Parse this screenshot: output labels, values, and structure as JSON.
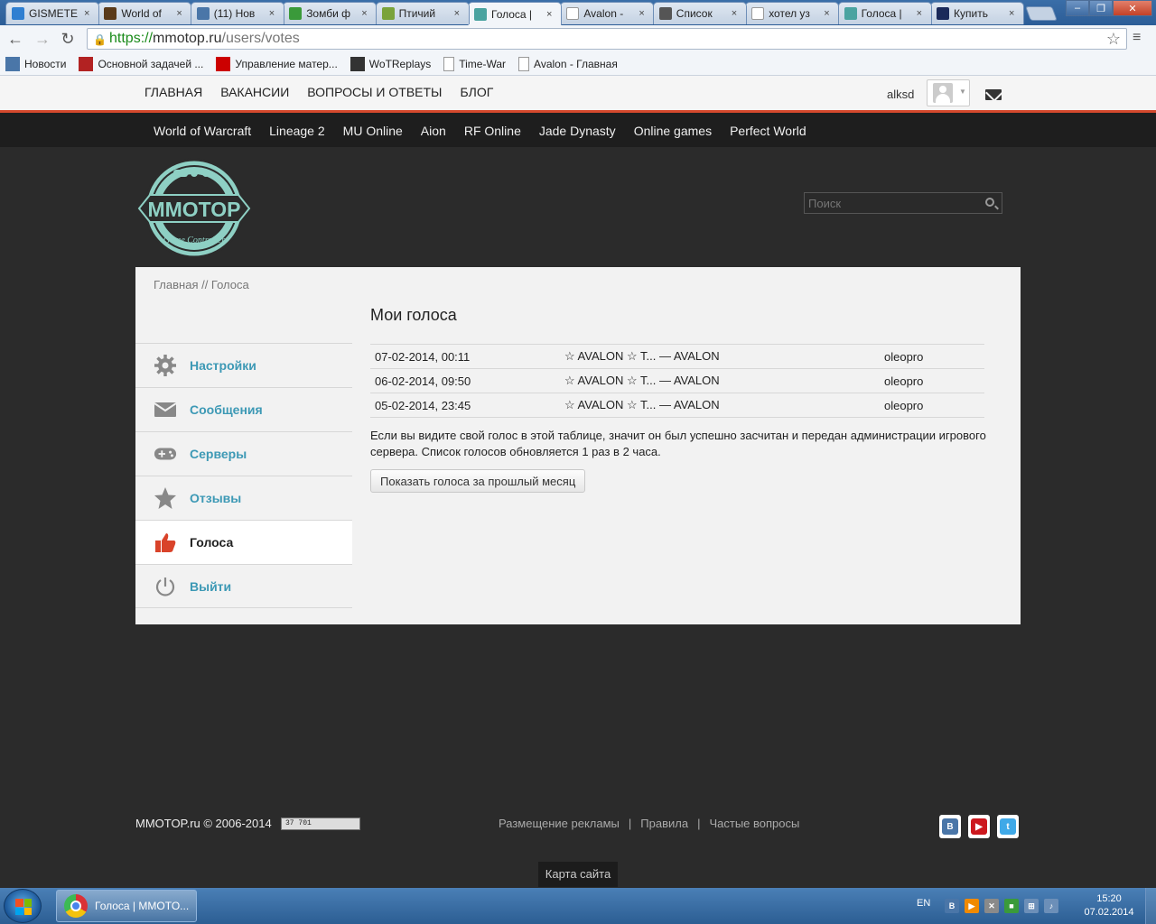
{
  "browser": {
    "tabs": [
      {
        "label": "GISMETE",
        "icon": "gismeteo-icon",
        "color": "#2f7fd1"
      },
      {
        "label": "World of",
        "icon": "wot-icon",
        "color": "#5a3a1a"
      },
      {
        "label": "(11) Нов",
        "icon": "vk-icon",
        "color": "#4a76a8"
      },
      {
        "label": "Зомби ф",
        "icon": "zombie-game-icon",
        "color": "#3a9a3a"
      },
      {
        "label": "Птичий",
        "icon": "bird-game-icon",
        "color": "#7aa33b"
      },
      {
        "label": "Голоса |",
        "icon": "mmotop-icon",
        "color": "#4aa3a0",
        "active": true
      },
      {
        "label": "Avalon -",
        "icon": "page-icon",
        "color": "#ffffff"
      },
      {
        "label": "Список",
        "icon": "gms-icon",
        "color": "#555555"
      },
      {
        "label": "хотел уз",
        "icon": "page-icon",
        "color": "#ffffff"
      },
      {
        "label": "Голоса |",
        "icon": "mmotop-icon",
        "color": "#4aa3a0"
      },
      {
        "label": "Купить",
        "icon": "shop-icon",
        "color": "#1b2a5a"
      }
    ],
    "url": {
      "scheme": "https://",
      "host": "mmotop.ru",
      "path": "/users/votes"
    },
    "bookmarks": [
      {
        "label": "Новости",
        "icon": "vk-icon",
        "color": "#4a76a8"
      },
      {
        "label": "Основной задачей ...",
        "icon": "b-icon",
        "color": "#b22222"
      },
      {
        "label": "Управление матер...",
        "icon": "aup-icon",
        "color": "#cc0000"
      },
      {
        "label": "WoTReplays",
        "icon": "camera-icon",
        "color": "#333333"
      },
      {
        "label": "Time-War",
        "icon": "page-icon",
        "color": "#ffffff"
      },
      {
        "label": "Avalon - Главная",
        "icon": "page-icon",
        "color": "#ffffff"
      }
    ]
  },
  "site": {
    "topnav": [
      "ГЛАВНАЯ",
      "ВАКАНСИИ",
      "ВОПРОСЫ И ОТВЕТЫ",
      "БЛОГ"
    ],
    "username": "alksd",
    "games": [
      "World of Warcraft",
      "Lineage 2",
      "MU Online",
      "Aion",
      "RF Online",
      "Jade Dynasty",
      "Online games",
      "Perfect World"
    ],
    "logo_text": "MMOTOP",
    "logo_sub": "Game Controller",
    "search_placeholder": "Поиск",
    "breadcrumb": "Главная // Голоса",
    "sidebar": [
      {
        "label": "Настройки",
        "icon": "gear-icon"
      },
      {
        "label": "Сообщения",
        "icon": "envelope-icon"
      },
      {
        "label": "Серверы",
        "icon": "gamepad-icon"
      },
      {
        "label": "Отзывы",
        "icon": "star-icon"
      },
      {
        "label": "Голоса",
        "icon": "thumbs-up-icon",
        "active": true
      },
      {
        "label": "Выйти",
        "icon": "power-icon"
      }
    ],
    "page_title": "Мои голоса",
    "votes": [
      {
        "date": "07-02-2014, 00:11",
        "server": "☆ AVALON ☆ T... — AVALON",
        "user": "oleopro"
      },
      {
        "date": "06-02-2014, 09:50",
        "server": "☆ AVALON ☆ T... — AVALON",
        "user": "oleopro"
      },
      {
        "date": "05-02-2014, 23:45",
        "server": "☆ AVALON ☆ T... — AVALON",
        "user": "oleopro"
      }
    ],
    "note": "Если вы видите свой голос в этой таблице, значит он был успешно засчитан и передан администрации игрового сервера. Список голосов обновляется 1 раз в 2 часа.",
    "prev_month_button": "Показать голоса за прошлый месяц",
    "copyright": "MMOTOP.ru © 2006-2014",
    "counter": "37 701",
    "footer_links": [
      "Размещение рекламы",
      "Правила",
      "Частые вопросы"
    ],
    "socials": [
      {
        "icon": "vk-icon",
        "text": "B",
        "color": "#4a76a8"
      },
      {
        "icon": "youtube-icon",
        "text": "▶",
        "color": "#cc181e"
      },
      {
        "icon": "twitter-icon",
        "text": "t",
        "color": "#3fa9e8"
      }
    ],
    "sitemap": "Карта сайта"
  },
  "taskbar": {
    "task_label": "Голоса | MMOTO...",
    "lang": "EN",
    "time": "15:20",
    "date": "07.02.2014"
  },
  "colors": {
    "accent_red": "#d4492d",
    "link_teal": "#3d99b5",
    "logo_teal": "#8ed0c4"
  }
}
